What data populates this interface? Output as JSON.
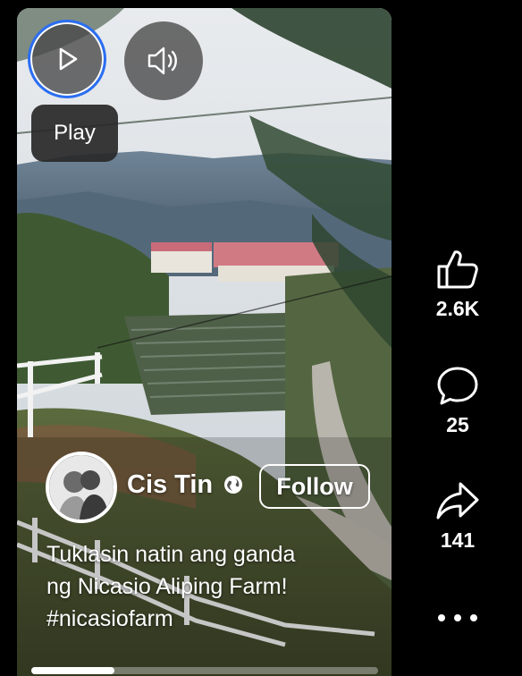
{
  "player": {
    "play_tooltip": "Play",
    "progress": 0.24
  },
  "author": {
    "name": "Cis Tin",
    "follow_label": "Follow"
  },
  "caption": {
    "lines": [
      "Tuklasin natin ang ganda",
      "ng Nicasio Aliping Farm!",
      "#nicasiofarm"
    ]
  },
  "actions": {
    "likes": "2.6K",
    "comments": "25",
    "shares": "141"
  },
  "icons": {
    "play": "play-icon",
    "sound": "speaker-icon",
    "like": "thumbs-up-icon",
    "comment": "comment-bubble-icon",
    "share": "share-arrow-icon",
    "more": "more-dots-icon",
    "privacy": "globe-icon"
  },
  "colors": {
    "focus_ring": "#2b6ff2",
    "background": "#000000"
  }
}
